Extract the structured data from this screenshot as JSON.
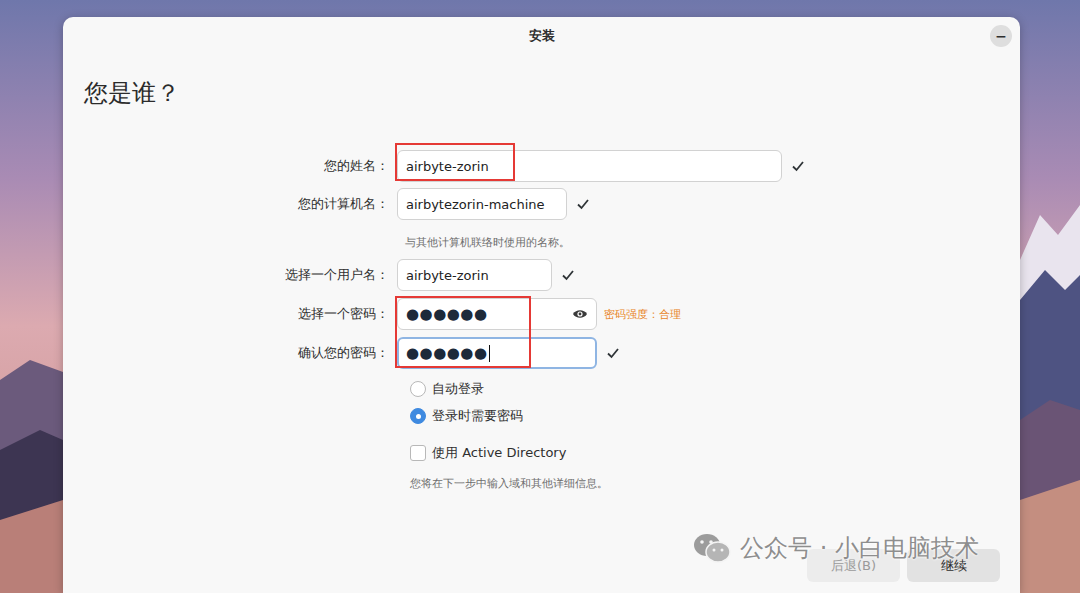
{
  "window": {
    "title": "安装",
    "minimize": "−"
  },
  "heading": "您是谁？",
  "fields": [
    {
      "kind": "text",
      "label": "您的姓名：",
      "value": "airbyte-zorin",
      "valid": true,
      "focused": false,
      "show_toggle": false,
      "annotated": true
    },
    {
      "kind": "text",
      "label": "您的计算机名：",
      "value": "airbytezorin-machine",
      "valid": true,
      "focused": false,
      "show_toggle": false,
      "annotated": false,
      "hint": "与其他计算机联络时使用的名称。"
    },
    {
      "kind": "text",
      "label": "选择一个用户名：",
      "value": "airbyte-zorin",
      "valid": true,
      "focused": false,
      "show_toggle": false,
      "annotated": false
    },
    {
      "kind": "password",
      "label": "选择一个密码：",
      "value": "●●●●●●",
      "valid": false,
      "focused": false,
      "show_toggle": true,
      "annotated": true,
      "strength": "密码强度：合理"
    },
    {
      "kind": "password",
      "label": "确认您的密码：",
      "value": "●●●●●●",
      "valid": true,
      "focused": true,
      "show_toggle": false,
      "annotated": true
    }
  ],
  "login_options": [
    {
      "label": "自动登录",
      "selected": false
    },
    {
      "label": "登录时需要密码",
      "selected": true
    }
  ],
  "active_directory": {
    "label": "使用 Active Directory",
    "checked": false,
    "hint": "您将在下一步中输入域和其他详细信息。"
  },
  "buttons": [
    {
      "label": "后退(B)",
      "disabled": true
    },
    {
      "label": "继续",
      "disabled": false
    }
  ],
  "watermark": "公众号 · 小白电脑技术"
}
